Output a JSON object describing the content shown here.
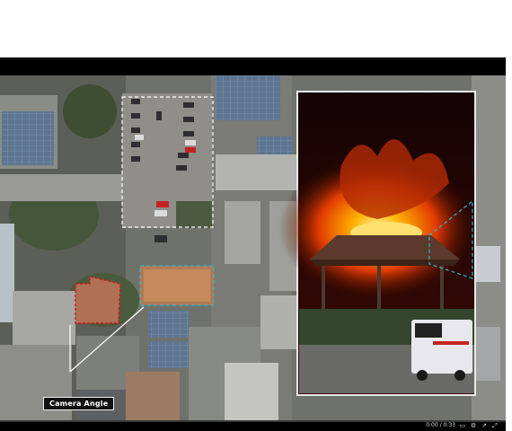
{
  "video": {
    "annotation_label": "Camera Angle"
  },
  "controls": {
    "time_text": "0:00 / 0:33",
    "progress": 0.0,
    "icons": [
      "captions-icon",
      "settings-icon",
      "external-open-icon",
      "fullscreen-icon"
    ]
  },
  "colors": {
    "player_bg": "#000000",
    "highlight_white": "#ffffff",
    "highlight_red": "#d01818",
    "highlight_cyan": "#2fb6d6",
    "fire": "#ff6a00"
  }
}
